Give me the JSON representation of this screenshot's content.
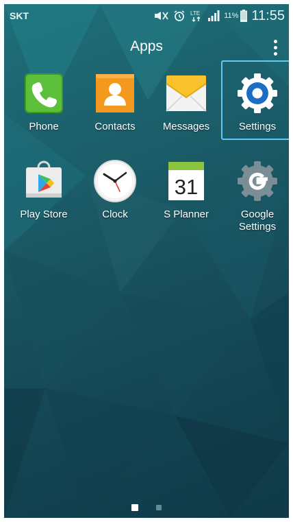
{
  "status_bar": {
    "carrier": "SKT",
    "icons": [
      "mute-icon",
      "alarm-icon",
      "lte-icon",
      "signal-icon",
      "battery-icon"
    ],
    "network": "LTE",
    "battery_percent": "11%",
    "time": "11:55"
  },
  "header": {
    "title": "Apps",
    "menu_icon": "more-vertical-icon"
  },
  "apps": [
    {
      "label": "Phone",
      "icon": "phone-icon",
      "color": "#4caf2e"
    },
    {
      "label": "Contacts",
      "icon": "contacts-icon",
      "color": "#f39a1e"
    },
    {
      "label": "Messages",
      "icon": "messages-icon",
      "color": "#f7c22c"
    },
    {
      "label": "Settings",
      "icon": "settings-icon",
      "color": "#1a6fc5",
      "selected": true
    },
    {
      "label": "Play Store",
      "icon": "play-store-icon",
      "color": "#e8e8e8"
    },
    {
      "label": "Clock",
      "icon": "clock-icon",
      "color": "#f2f2f2"
    },
    {
      "label": "S Planner",
      "icon": "calendar-icon",
      "color": "#8bc53f",
      "calendar_day": "31"
    },
    {
      "label": "Google\nSettings",
      "icon": "google-settings-icon",
      "color": "#7b8e98"
    }
  ],
  "page_indicator": {
    "current": 1,
    "total": 2
  },
  "colors": {
    "selection_border": "#61c9f3"
  }
}
